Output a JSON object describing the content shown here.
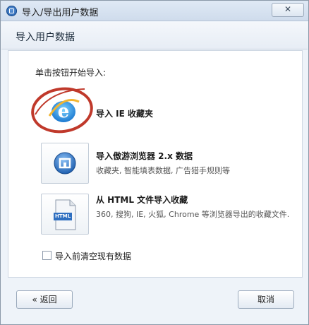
{
  "window": {
    "title": "导入/导出用户数据",
    "close_label": "✕"
  },
  "header": {
    "title": "导入用户数据"
  },
  "main": {
    "instruction": "单击按钮开始导入:",
    "options": [
      {
        "title": "导入 IE 收藏夹",
        "description": "",
        "icon": "ie-icon"
      },
      {
        "title": "导入傲游浏览器 2.x 数据",
        "description": "收藏夹, 智能填表数据, 广告猎手规则等",
        "icon": "maxthon-icon"
      },
      {
        "title": "从 HTML 文件导入收藏",
        "description": "360, 搜狗, IE, 火狐, Chrome 等浏览器导出的收藏文件.",
        "icon": "html-file-icon",
        "icon_text": "HTML"
      }
    ],
    "clear_checkbox": {
      "label": "导入前清空现有数据",
      "checked": false
    }
  },
  "footer": {
    "back_label": "« 返回",
    "cancel_label": "取消"
  },
  "colors": {
    "accent": "#1e6fc4",
    "highlight_circle": "#c0392b"
  }
}
